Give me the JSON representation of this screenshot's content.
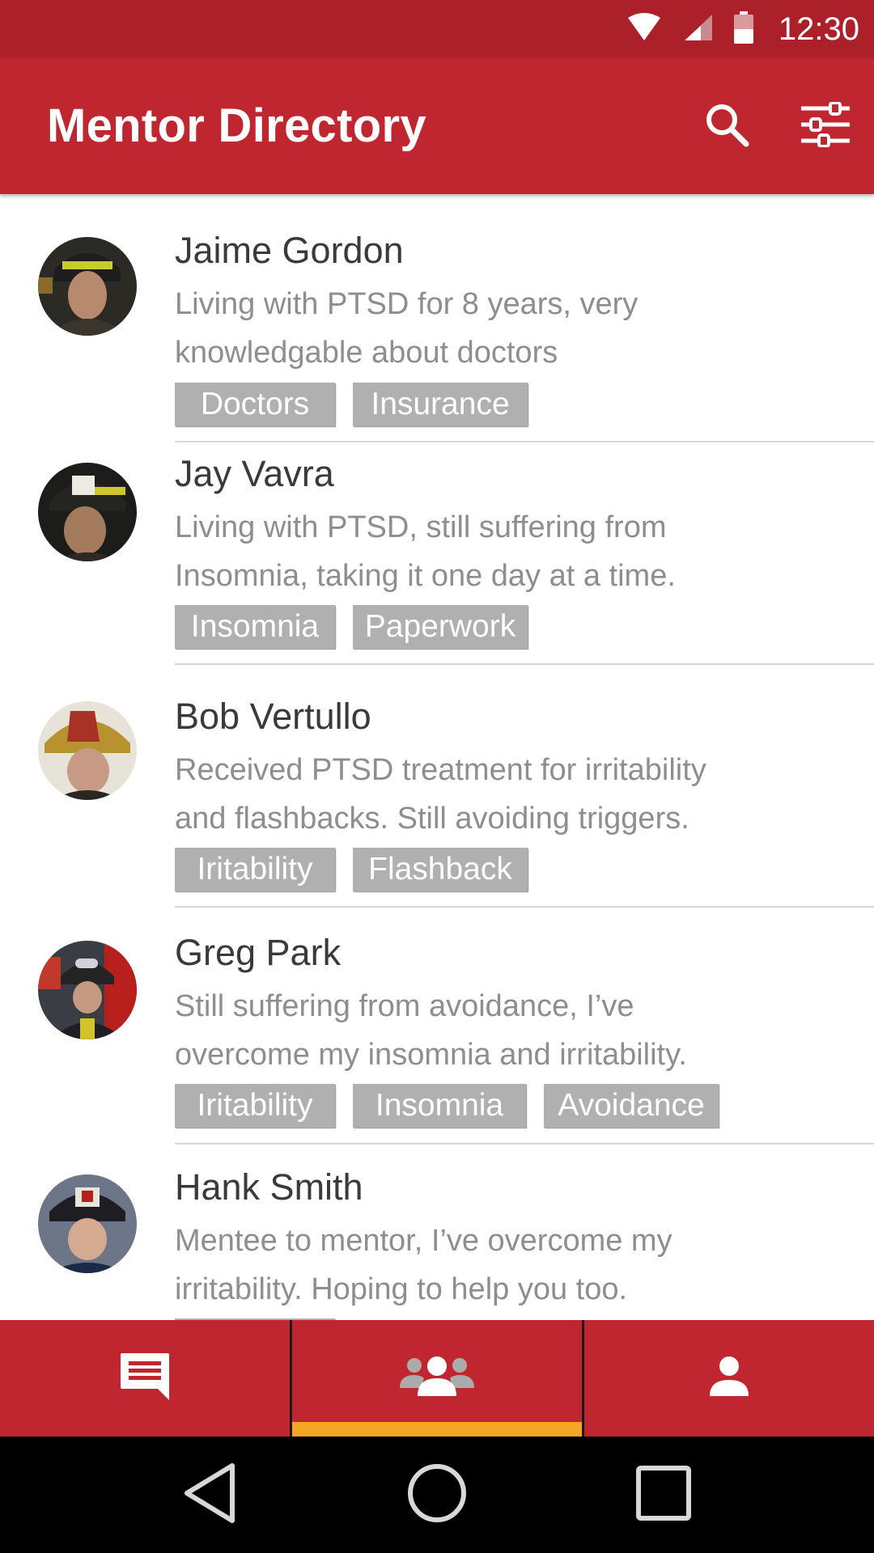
{
  "status_bar": {
    "time": "12:30"
  },
  "app_bar": {
    "title": "Mentor Directory",
    "search_icon": "search-icon",
    "filter_icon": "filter-icon"
  },
  "mentors": [
    {
      "name": "Jaime Gordon",
      "bio_line1": "Living with PTSD for 8 years, very",
      "bio_line2": "knowledgable about doctors",
      "tags": [
        "Doctors",
        "Insurance"
      ]
    },
    {
      "name": "Jay Vavra",
      "bio_line1": "Living with PTSD, still suffering from",
      "bio_line2": "Insomnia, taking it one day at a time.",
      "tags": [
        "Insomnia",
        "Paperwork"
      ]
    },
    {
      "name": "Bob Vertullo",
      "bio_line1": "Received PTSD treatment for irritability",
      "bio_line2": "and flashbacks. Still avoiding triggers.",
      "tags": [
        "Iritability",
        "Flashback"
      ]
    },
    {
      "name": "Greg Park",
      "bio_line1": "Still suffering from avoidance, I’ve",
      "bio_line2": "overcome my insomnia and irritability.",
      "tags": [
        "Iritability",
        "Insomnia",
        "Avoidance"
      ]
    },
    {
      "name": "Hank Smith",
      "bio_line1": "Mentee to mentor, I’ve overcome my",
      "bio_line2": "irritability. Hoping to help you too.",
      "tags": [
        ""
      ]
    }
  ],
  "bottom_nav": {
    "tabs": [
      "messages-icon",
      "mentors-icon",
      "profile-icon"
    ],
    "active_tab": 1
  },
  "system_nav": [
    "back-icon",
    "home-icon",
    "recents-icon"
  ],
  "colors": {
    "primary": "#c0262f",
    "status_bar": "#ac2129",
    "accent": "#f5a623",
    "tag": "#b0b0b0"
  }
}
